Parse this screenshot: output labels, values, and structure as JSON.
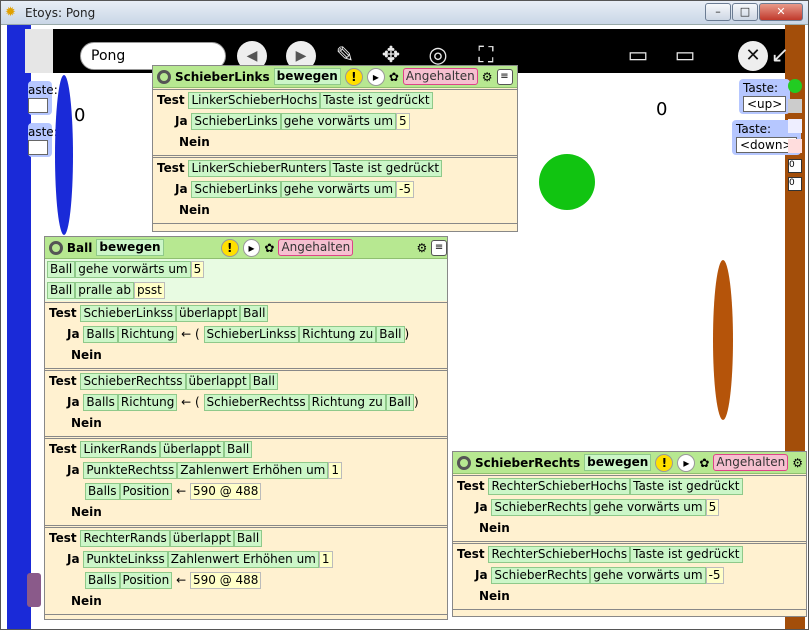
{
  "window": {
    "title": "Etoys: Pong",
    "min": "–",
    "max": "□",
    "close": "✕"
  },
  "nav": {
    "project_name": "Pong",
    "prev": "◀",
    "next": "▶",
    "close": "✕"
  },
  "scores": {
    "left": "0",
    "right": "0"
  },
  "keys": {
    "up_label": "Taste:",
    "up_value": "<up>",
    "down_label": "Taste:",
    "down_value": "<down>",
    "partial_label": "aste:"
  },
  "script_left": {
    "object": "SchieberLinks",
    "script": "bewegen",
    "status": "Angehalten",
    "test1": {
      "test": "Test",
      "cond": "LinkerSchieberHochs",
      "cond2": "Taste ist gedrückt",
      "ja": "Ja",
      "obj": "SchieberLinks",
      "cmd": "gehe vorwärts um",
      "val": "5",
      "nein": "Nein"
    },
    "test2": {
      "test": "Test",
      "cond": "LinkerSchieberRunters",
      "cond2": "Taste ist gedrückt",
      "ja": "Ja",
      "obj": "SchieberLinks",
      "cmd": "gehe vorwärts um",
      "val": "-5",
      "nein": "Nein"
    }
  },
  "script_ball": {
    "object": "Ball",
    "script": "bewegen",
    "status": "Angehalten",
    "line1": {
      "obj": "Ball",
      "cmd": "gehe vorwärts um",
      "val": "5"
    },
    "line2": {
      "obj": "Ball",
      "cmd": "pralle ab",
      "val": "psst"
    },
    "test1": {
      "test": "Test",
      "a": "SchieberLinkss",
      "b": "überlappt",
      "c": "Ball",
      "ja": "Ja",
      "obj": "Balls",
      "prop": "Richtung",
      "op": "←",
      "x": "SchieberLinkss",
      "y": "Richtung zu",
      "z": "Ball",
      "nein": "Nein"
    },
    "test2": {
      "test": "Test",
      "a": "SchieberRechtss",
      "b": "überlappt",
      "c": "Ball",
      "ja": "Ja",
      "obj": "Balls",
      "prop": "Richtung",
      "op": "←",
      "x": "SchieberRechtss",
      "y": "Richtung zu",
      "z": "Ball",
      "nein": "Nein"
    },
    "test3": {
      "test": "Test",
      "a": "LinkerRands",
      "b": "überlappt",
      "c": "Ball",
      "ja": "Ja",
      "s1obj": "PunkteRechtss",
      "s1cmd": "Zahlenwert Erhöhen um",
      "s1val": "1",
      "s2obj": "Balls",
      "s2prop": "Position",
      "s2op": "←",
      "s2val": "590 @ 488",
      "nein": "Nein"
    },
    "test4": {
      "test": "Test",
      "a": "RechterRands",
      "b": "überlappt",
      "c": "Ball",
      "ja": "Ja",
      "s1obj": "PunkteLinkss",
      "s1cmd": "Zahlenwert Erhöhen um",
      "s1val": "1",
      "s2obj": "Balls",
      "s2prop": "Position",
      "s2op": "←",
      "s2val": "590 @ 488",
      "nein": "Nein"
    }
  },
  "script_right": {
    "object": "SchieberRechts",
    "script": "bewegen",
    "status": "Angehalten",
    "test1": {
      "test": "Test",
      "cond": "RechterSchieberHochs",
      "cond2": "Taste ist gedrückt",
      "ja": "Ja",
      "obj": "SchieberRechts",
      "cmd": "gehe vorwärts um",
      "val": "5",
      "nein": "Nein"
    },
    "test2": {
      "test": "Test",
      "cond": "RechterSchieberHochs",
      "cond2": "Taste ist gedrückt",
      "ja": "Ja",
      "obj": "SchieberRechts",
      "cmd": "gehe vorwärts um",
      "val": "-5",
      "nein": "Nein"
    }
  },
  "colors": {
    "left_paddle": "#1a2ad8",
    "right_paddle": "#b5540a",
    "ball": "#11c411",
    "script_header": "#b7e891",
    "script_body": "#fff1d0"
  }
}
